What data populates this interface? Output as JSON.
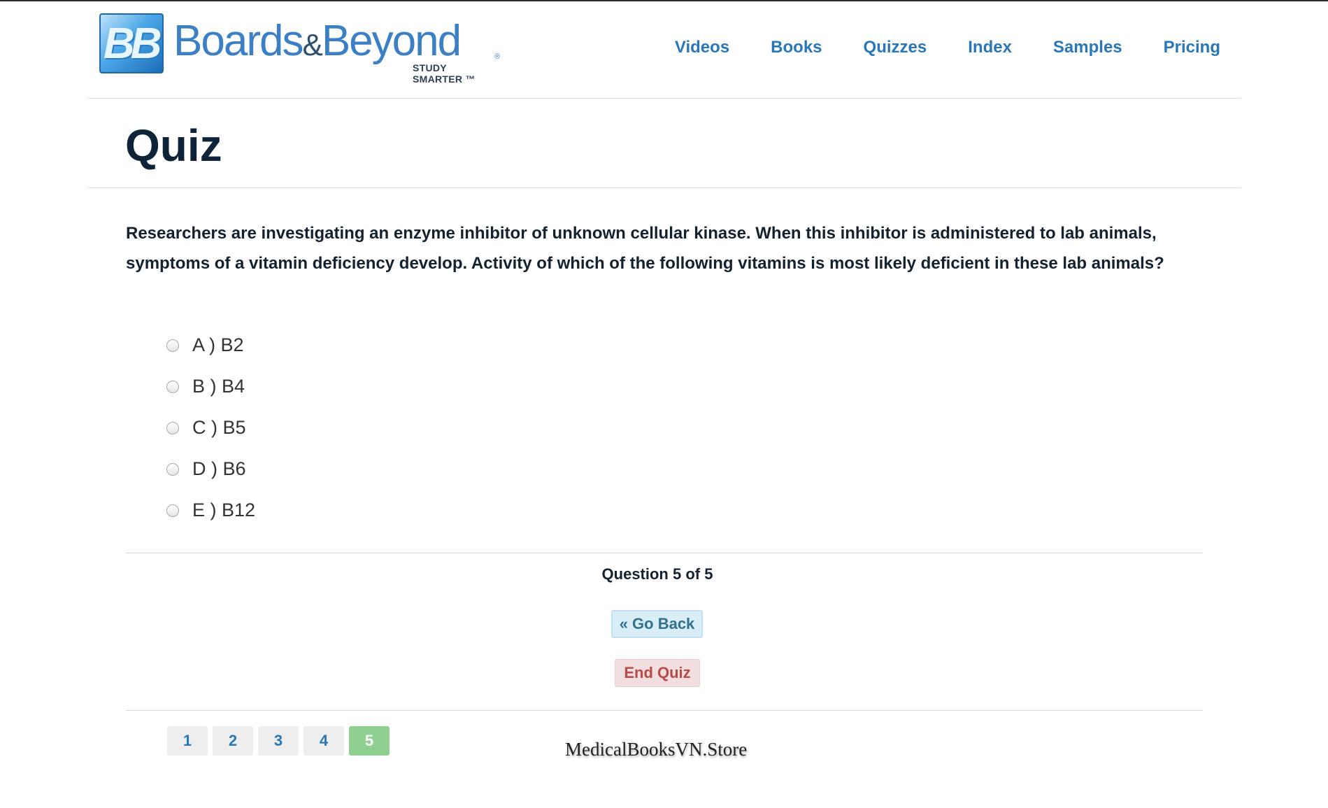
{
  "header": {
    "logo": {
      "mark": "BB",
      "word_a": "Boards",
      "amp": "&",
      "word_b": "Beyond",
      "tagline": "STUDY SMARTER ™",
      "reg": "®"
    },
    "nav": [
      "Videos",
      "Books",
      "Quizzes",
      "Index",
      "Samples",
      "Pricing"
    ]
  },
  "page": {
    "title": "Quiz"
  },
  "quiz": {
    "question": "Researchers are investigating an enzyme inhibitor of unknown cellular kinase. When this inhibitor is administered to lab animals, symptoms of a vitamin deficiency develop. Activity of which of the following vitamins is most likely deficient in these lab animals?",
    "options": [
      "A ) B2",
      "B ) B4",
      "C ) B5",
      "D ) B6",
      "E ) B12"
    ],
    "progress": "Question 5 of 5",
    "go_back_label": "« Go Back",
    "end_quiz_label": "End Quiz"
  },
  "pager": {
    "pages": [
      "1",
      "2",
      "3",
      "4",
      "5"
    ],
    "current": "5"
  },
  "watermark": "MedicalBooksVN.Store",
  "colors": {
    "nav": "#2a77b8",
    "active_page": "#8fcf8f",
    "go_back_bg": "#d9edf7",
    "end_quiz_bg": "#f2dede"
  }
}
